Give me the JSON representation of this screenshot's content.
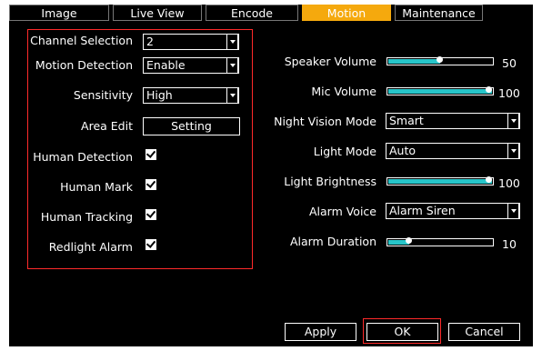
{
  "tabs": [
    {
      "label": "Image"
    },
    {
      "label": "Live View"
    },
    {
      "label": "Encode"
    },
    {
      "label": "Motion"
    },
    {
      "label": "Maintenance"
    }
  ],
  "left": {
    "channel_selection": {
      "label": "Channel Selection",
      "value": "2"
    },
    "motion_detection": {
      "label": "Motion Detection",
      "value": "Enable"
    },
    "sensitivity": {
      "label": "Sensitivity",
      "value": "High"
    },
    "area_edit": {
      "label": "Area Edit",
      "button": "Setting"
    },
    "human_detection": {
      "label": "Human Detection",
      "checked": true
    },
    "human_mark": {
      "label": "Human Mark",
      "checked": true
    },
    "human_tracking": {
      "label": "Human Tracking",
      "checked": true
    },
    "redlight_alarm": {
      "label": "Redlight Alarm",
      "checked": true
    }
  },
  "right": {
    "speaker_volume": {
      "label": "Speaker Volume",
      "value": "50",
      "level": 0.5
    },
    "mic_volume": {
      "label": "Mic Volume",
      "value": "100",
      "level": 1.0
    },
    "night_vision_mode": {
      "label": "Night Vision Mode",
      "value": "Smart"
    },
    "light_mode": {
      "label": "Light Mode",
      "value": "Auto"
    },
    "light_brightness": {
      "label": "Light Brightness",
      "value": "100",
      "level": 1.0
    },
    "alarm_voice": {
      "label": "Alarm Voice",
      "value": "Alarm Siren"
    },
    "alarm_duration": {
      "label": "Alarm Duration",
      "value": "10",
      "level": 0.2
    }
  },
  "buttons": {
    "apply": "Apply",
    "ok": "OK",
    "cancel": "Cancel"
  },
  "colors": {
    "active_tab": "#f5a90d",
    "slider_fill": "#27c5c9",
    "highlight": "#ff2a2a",
    "panel": "#000000"
  }
}
